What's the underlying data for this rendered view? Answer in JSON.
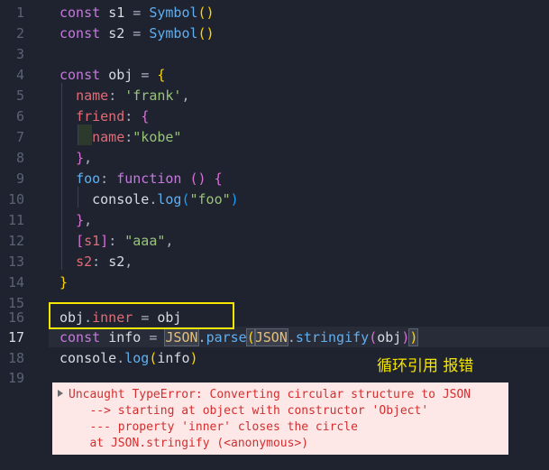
{
  "editor": {
    "line_numbers": [
      "1",
      "2",
      "3",
      "4",
      "5",
      "6",
      "7",
      "8",
      "9",
      "10",
      "11",
      "12",
      "13",
      "14",
      "15",
      "16",
      "17",
      "18",
      "19"
    ],
    "active_line": "17",
    "code": {
      "l1": [
        "const",
        "s1",
        "=",
        "Symbol",
        "()"
      ],
      "l2": [
        "const",
        "s2",
        "=",
        "Symbol",
        "()"
      ],
      "l4": [
        "const",
        "obj",
        "=",
        "{"
      ],
      "l5": [
        "name",
        ":",
        "'frank'",
        ","
      ],
      "l6": [
        "friend",
        ":",
        "{"
      ],
      "l7": [
        "name",
        ":",
        "\"kobe\""
      ],
      "l8": [
        "}",
        ","
      ],
      "l9": [
        "foo",
        ":",
        "function",
        "()",
        "{"
      ],
      "l10": [
        "console",
        ".",
        "log",
        "(",
        "\"foo\"",
        ")"
      ],
      "l11": [
        "}",
        ","
      ],
      "l12": [
        "[",
        "s1",
        "]",
        ":",
        "\"aaa\"",
        ","
      ],
      "l13": [
        "s2",
        ":",
        "s2",
        ","
      ],
      "l14": [
        "}"
      ],
      "l16": [
        "obj",
        ".",
        "inner",
        "=",
        "obj"
      ],
      "l17": [
        "const",
        "info",
        "=",
        "JSON",
        ".",
        "parse",
        "(",
        "JSON",
        ".",
        "stringify",
        "(",
        "obj",
        ")",
        ")"
      ],
      "l18": [
        "console",
        ".",
        "log",
        "(",
        "info",
        ")"
      ]
    }
  },
  "annotation": "循环引用 报错",
  "error": {
    "lines": [
      "Uncaught TypeError: Converting circular structure to JSON",
      "   --> starting at object with constructor 'Object'",
      "   --- property 'inner' closes the circle",
      "   at JSON.stringify (<anonymous>)"
    ]
  },
  "colors": {
    "background": "#1f2330",
    "highlight_box": "#f5e600",
    "error_bg": "#fde7e7",
    "error_text": "#d32f2f"
  }
}
